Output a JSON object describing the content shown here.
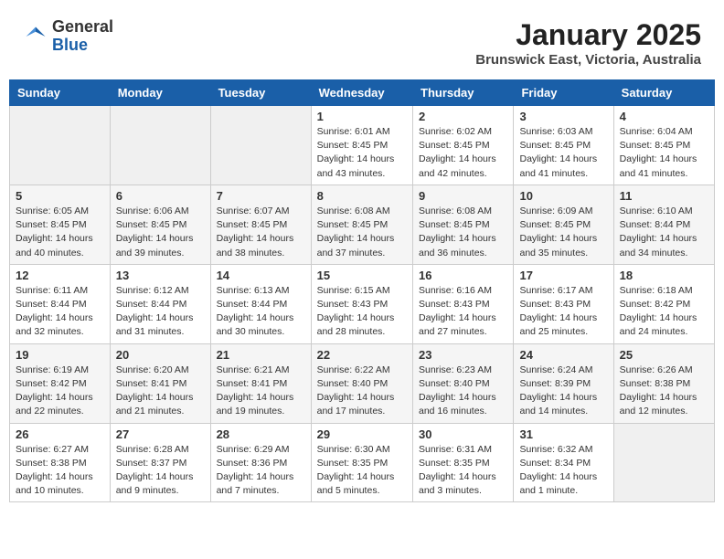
{
  "header": {
    "logo_general": "General",
    "logo_blue": "Blue",
    "month_title": "January 2025",
    "location": "Brunswick East, Victoria, Australia"
  },
  "weekdays": [
    "Sunday",
    "Monday",
    "Tuesday",
    "Wednesday",
    "Thursday",
    "Friday",
    "Saturday"
  ],
  "weeks": [
    [
      {
        "day": "",
        "info": ""
      },
      {
        "day": "",
        "info": ""
      },
      {
        "day": "",
        "info": ""
      },
      {
        "day": "1",
        "info": "Sunrise: 6:01 AM\nSunset: 8:45 PM\nDaylight: 14 hours\nand 43 minutes."
      },
      {
        "day": "2",
        "info": "Sunrise: 6:02 AM\nSunset: 8:45 PM\nDaylight: 14 hours\nand 42 minutes."
      },
      {
        "day": "3",
        "info": "Sunrise: 6:03 AM\nSunset: 8:45 PM\nDaylight: 14 hours\nand 41 minutes."
      },
      {
        "day": "4",
        "info": "Sunrise: 6:04 AM\nSunset: 8:45 PM\nDaylight: 14 hours\nand 41 minutes."
      }
    ],
    [
      {
        "day": "5",
        "info": "Sunrise: 6:05 AM\nSunset: 8:45 PM\nDaylight: 14 hours\nand 40 minutes."
      },
      {
        "day": "6",
        "info": "Sunrise: 6:06 AM\nSunset: 8:45 PM\nDaylight: 14 hours\nand 39 minutes."
      },
      {
        "day": "7",
        "info": "Sunrise: 6:07 AM\nSunset: 8:45 PM\nDaylight: 14 hours\nand 38 minutes."
      },
      {
        "day": "8",
        "info": "Sunrise: 6:08 AM\nSunset: 8:45 PM\nDaylight: 14 hours\nand 37 minutes."
      },
      {
        "day": "9",
        "info": "Sunrise: 6:08 AM\nSunset: 8:45 PM\nDaylight: 14 hours\nand 36 minutes."
      },
      {
        "day": "10",
        "info": "Sunrise: 6:09 AM\nSunset: 8:45 PM\nDaylight: 14 hours\nand 35 minutes."
      },
      {
        "day": "11",
        "info": "Sunrise: 6:10 AM\nSunset: 8:44 PM\nDaylight: 14 hours\nand 34 minutes."
      }
    ],
    [
      {
        "day": "12",
        "info": "Sunrise: 6:11 AM\nSunset: 8:44 PM\nDaylight: 14 hours\nand 32 minutes."
      },
      {
        "day": "13",
        "info": "Sunrise: 6:12 AM\nSunset: 8:44 PM\nDaylight: 14 hours\nand 31 minutes."
      },
      {
        "day": "14",
        "info": "Sunrise: 6:13 AM\nSunset: 8:44 PM\nDaylight: 14 hours\nand 30 minutes."
      },
      {
        "day": "15",
        "info": "Sunrise: 6:15 AM\nSunset: 8:43 PM\nDaylight: 14 hours\nand 28 minutes."
      },
      {
        "day": "16",
        "info": "Sunrise: 6:16 AM\nSunset: 8:43 PM\nDaylight: 14 hours\nand 27 minutes."
      },
      {
        "day": "17",
        "info": "Sunrise: 6:17 AM\nSunset: 8:43 PM\nDaylight: 14 hours\nand 25 minutes."
      },
      {
        "day": "18",
        "info": "Sunrise: 6:18 AM\nSunset: 8:42 PM\nDaylight: 14 hours\nand 24 minutes."
      }
    ],
    [
      {
        "day": "19",
        "info": "Sunrise: 6:19 AM\nSunset: 8:42 PM\nDaylight: 14 hours\nand 22 minutes."
      },
      {
        "day": "20",
        "info": "Sunrise: 6:20 AM\nSunset: 8:41 PM\nDaylight: 14 hours\nand 21 minutes."
      },
      {
        "day": "21",
        "info": "Sunrise: 6:21 AM\nSunset: 8:41 PM\nDaylight: 14 hours\nand 19 minutes."
      },
      {
        "day": "22",
        "info": "Sunrise: 6:22 AM\nSunset: 8:40 PM\nDaylight: 14 hours\nand 17 minutes."
      },
      {
        "day": "23",
        "info": "Sunrise: 6:23 AM\nSunset: 8:40 PM\nDaylight: 14 hours\nand 16 minutes."
      },
      {
        "day": "24",
        "info": "Sunrise: 6:24 AM\nSunset: 8:39 PM\nDaylight: 14 hours\nand 14 minutes."
      },
      {
        "day": "25",
        "info": "Sunrise: 6:26 AM\nSunset: 8:38 PM\nDaylight: 14 hours\nand 12 minutes."
      }
    ],
    [
      {
        "day": "26",
        "info": "Sunrise: 6:27 AM\nSunset: 8:38 PM\nDaylight: 14 hours\nand 10 minutes."
      },
      {
        "day": "27",
        "info": "Sunrise: 6:28 AM\nSunset: 8:37 PM\nDaylight: 14 hours\nand 9 minutes."
      },
      {
        "day": "28",
        "info": "Sunrise: 6:29 AM\nSunset: 8:36 PM\nDaylight: 14 hours\nand 7 minutes."
      },
      {
        "day": "29",
        "info": "Sunrise: 6:30 AM\nSunset: 8:35 PM\nDaylight: 14 hours\nand 5 minutes."
      },
      {
        "day": "30",
        "info": "Sunrise: 6:31 AM\nSunset: 8:35 PM\nDaylight: 14 hours\nand 3 minutes."
      },
      {
        "day": "31",
        "info": "Sunrise: 6:32 AM\nSunset: 8:34 PM\nDaylight: 14 hours\nand 1 minute."
      },
      {
        "day": "",
        "info": ""
      }
    ]
  ]
}
